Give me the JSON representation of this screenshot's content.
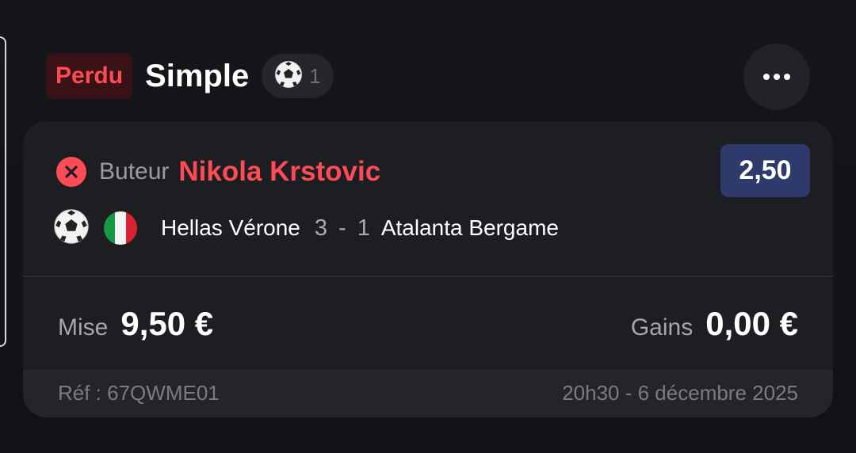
{
  "bet": {
    "status": "Perdu",
    "type": "Simple",
    "selection_count": "1",
    "sport_icon": "soccer-ball-icon"
  },
  "selection": {
    "market": "Buteur",
    "player": "Nikola Krstovic",
    "odds": "2,50",
    "result_icon": "x-circle-icon",
    "country_flag": "italy-flag-icon"
  },
  "match": {
    "home_team": "Hellas Vérone",
    "home_score": "3",
    "separator": "-",
    "away_score": "1",
    "away_team": "Atalanta Bergame"
  },
  "amounts": {
    "stake_label": "Mise",
    "stake_value": "9,50 €",
    "gain_label": "Gains",
    "gain_value": "0,00 €"
  },
  "footer": {
    "reference": "Réf : 67QWME01",
    "datetime": "20h30 - 6 décembre 2025"
  },
  "colors": {
    "lost_red": "#ff4b55",
    "odds_badge": "#2d3a6b",
    "card_bg": "#1d1e22"
  }
}
